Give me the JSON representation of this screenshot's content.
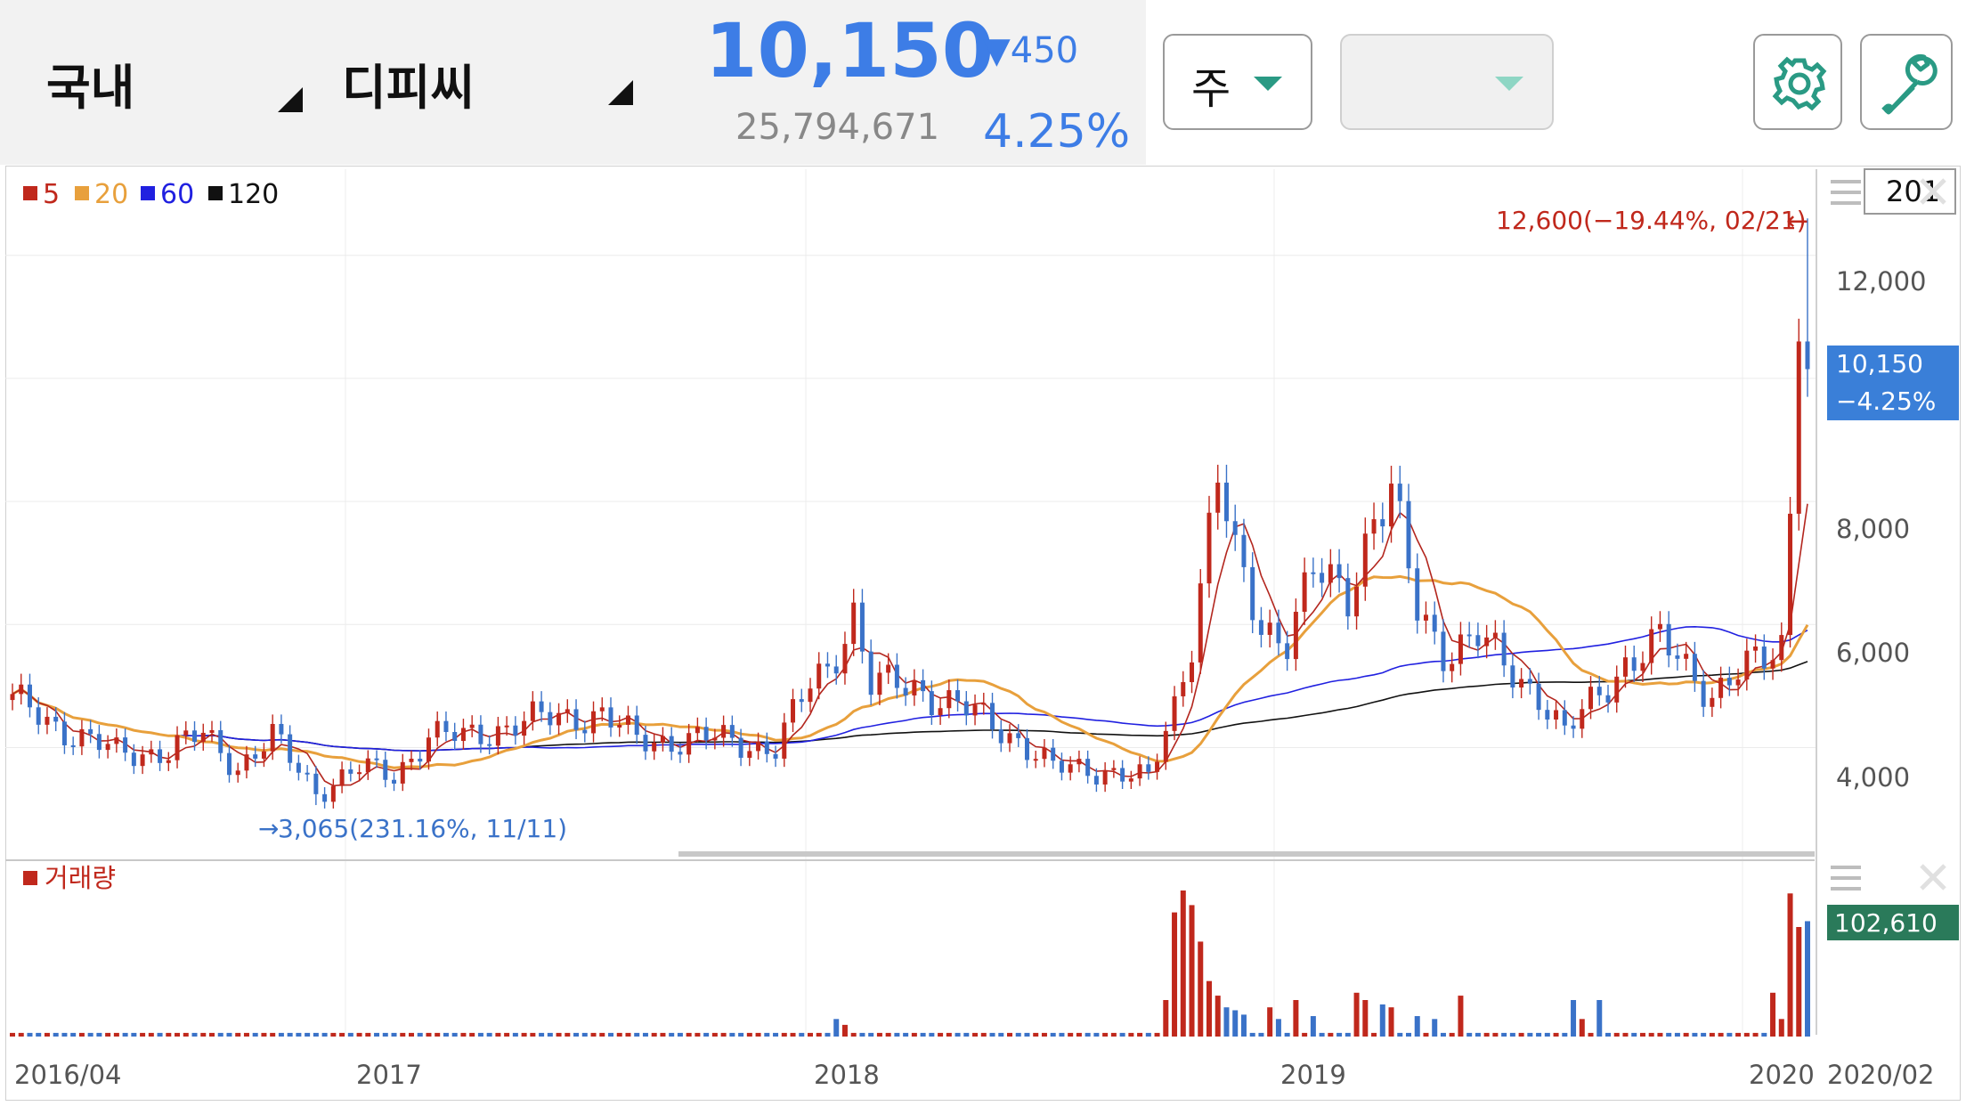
{
  "header": {
    "market_label": "국내",
    "stock_name": "디피씨",
    "price": "10,150",
    "change": "▼450",
    "volume": "25,794,671",
    "change_pct": "4.25%",
    "period_label": "주",
    "indicator_label": "",
    "settings_icon": "gear-icon",
    "tools_icon": "wrench-icon"
  },
  "colors": {
    "up": "#c0281c",
    "down": "#3a72c8",
    "ma5": "#b3261e",
    "ma20": "#e8a03c",
    "ma60": "#2020e0",
    "ma120": "#111111",
    "accent": "#3d7de6",
    "green": "#2a9a84"
  },
  "chart_data": {
    "type": "candlestick",
    "period": "weekly",
    "legend": [
      {
        "name": "5",
        "color": "#c0281c"
      },
      {
        "name": "20",
        "color": "#e8a03c"
      },
      {
        "name": "60",
        "color": "#2020e0"
      },
      {
        "name": "120",
        "color": "#111111"
      }
    ],
    "price_axis": {
      "ticks": [
        "12,000",
        "8,000",
        "6,000",
        "4,000"
      ],
      "range": [
        2400,
        13400
      ]
    },
    "x_ticks": [
      "2016/04",
      "2017",
      "2018",
      "2019",
      "2020",
      "2020/02"
    ],
    "top_menu_value": "201",
    "high_annotation": "12,600(−19.44%, 02/21)",
    "low_annotation": "3,065(231.16%, 11/11)",
    "last_price_label": "10,150",
    "last_change_label": "−4.25%",
    "volume_label": "거래량",
    "volume_value_label": "102,610",
    "anchors": [
      {
        "w": 0,
        "p": 4750
      },
      {
        "w": 6,
        "p": 4300
      },
      {
        "w": 12,
        "p": 3900
      },
      {
        "w": 18,
        "p": 3950
      },
      {
        "w": 22,
        "p": 4200
      },
      {
        "w": 26,
        "p": 3700
      },
      {
        "w": 30,
        "p": 4150
      },
      {
        "w": 35,
        "p": 3300
      },
      {
        "w": 40,
        "p": 3650
      },
      {
        "w": 44,
        "p": 3550
      },
      {
        "w": 48,
        "p": 4200
      },
      {
        "w": 52,
        "p": 4150
      },
      {
        "w": 58,
        "p": 4400
      },
      {
        "w": 64,
        "p": 4500
      },
      {
        "w": 68,
        "p": 4550
      },
      {
        "w": 72,
        "p": 4100
      },
      {
        "w": 80,
        "p": 4150
      },
      {
        "w": 88,
        "p": 4000
      },
      {
        "w": 92,
        "p": 5000
      },
      {
        "w": 94,
        "p": 5300
      },
      {
        "w": 97,
        "p": 6200
      },
      {
        "w": 99,
        "p": 5000
      },
      {
        "w": 104,
        "p": 5000
      },
      {
        "w": 110,
        "p": 4600
      },
      {
        "w": 116,
        "p": 4150
      },
      {
        "w": 120,
        "p": 3650
      },
      {
        "w": 126,
        "p": 3650
      },
      {
        "w": 131,
        "p": 3450
      },
      {
        "w": 134,
        "p": 4700
      },
      {
        "w": 136,
        "p": 5800
      },
      {
        "w": 139,
        "p": 8400
      },
      {
        "w": 141,
        "p": 7000
      },
      {
        "w": 144,
        "p": 6000
      },
      {
        "w": 147,
        "p": 5800
      },
      {
        "w": 150,
        "p": 6800
      },
      {
        "w": 154,
        "p": 6500
      },
      {
        "w": 157,
        "p": 7800
      },
      {
        "w": 159,
        "p": 8100
      },
      {
        "w": 162,
        "p": 6200
      },
      {
        "w": 165,
        "p": 5600
      },
      {
        "w": 169,
        "p": 5800
      },
      {
        "w": 172,
        "p": 5300
      },
      {
        "w": 176,
        "p": 4900
      },
      {
        "w": 179,
        "p": 4200
      },
      {
        "w": 182,
        "p": 4700
      },
      {
        "w": 186,
        "p": 5400
      },
      {
        "w": 190,
        "p": 5700
      },
      {
        "w": 193,
        "p": 5300
      },
      {
        "w": 196,
        "p": 4900
      },
      {
        "w": 199,
        "p": 5200
      },
      {
        "w": 202,
        "p": 5400
      },
      {
        "w": 204,
        "p": 5700
      },
      {
        "w": 205,
        "p": 7800
      },
      {
        "w": 206,
        "p": 10600
      },
      {
        "w": 207,
        "p": 10150
      }
    ],
    "volume_levels": [
      {
        "w": 95,
        "v": 0.12
      },
      {
        "w": 96,
        "v": 0.08
      },
      {
        "w": 133,
        "v": 0.25
      },
      {
        "w": 134,
        "v": 0.85
      },
      {
        "w": 135,
        "v": 1.0
      },
      {
        "w": 136,
        "v": 0.9
      },
      {
        "w": 137,
        "v": 0.65
      },
      {
        "w": 138,
        "v": 0.38
      },
      {
        "w": 139,
        "v": 0.28
      },
      {
        "w": 140,
        "v": 0.2
      },
      {
        "w": 141,
        "v": 0.18
      },
      {
        "w": 142,
        "v": 0.15
      },
      {
        "w": 145,
        "v": 0.2
      },
      {
        "w": 146,
        "v": 0.12
      },
      {
        "w": 148,
        "v": 0.25
      },
      {
        "w": 150,
        "v": 0.14
      },
      {
        "w": 155,
        "v": 0.3
      },
      {
        "w": 156,
        "v": 0.25
      },
      {
        "w": 158,
        "v": 0.22
      },
      {
        "w": 159,
        "v": 0.2
      },
      {
        "w": 162,
        "v": 0.14
      },
      {
        "w": 164,
        "v": 0.12
      },
      {
        "w": 167,
        "v": 0.28
      },
      {
        "w": 180,
        "v": 0.25
      },
      {
        "w": 181,
        "v": 0.12
      },
      {
        "w": 183,
        "v": 0.25
      },
      {
        "w": 203,
        "v": 0.3
      },
      {
        "w": 204,
        "v": 0.12
      },
      {
        "w": 205,
        "v": 0.98
      },
      {
        "w": 206,
        "v": 0.75
      },
      {
        "w": 207,
        "v": 0.79
      }
    ]
  }
}
